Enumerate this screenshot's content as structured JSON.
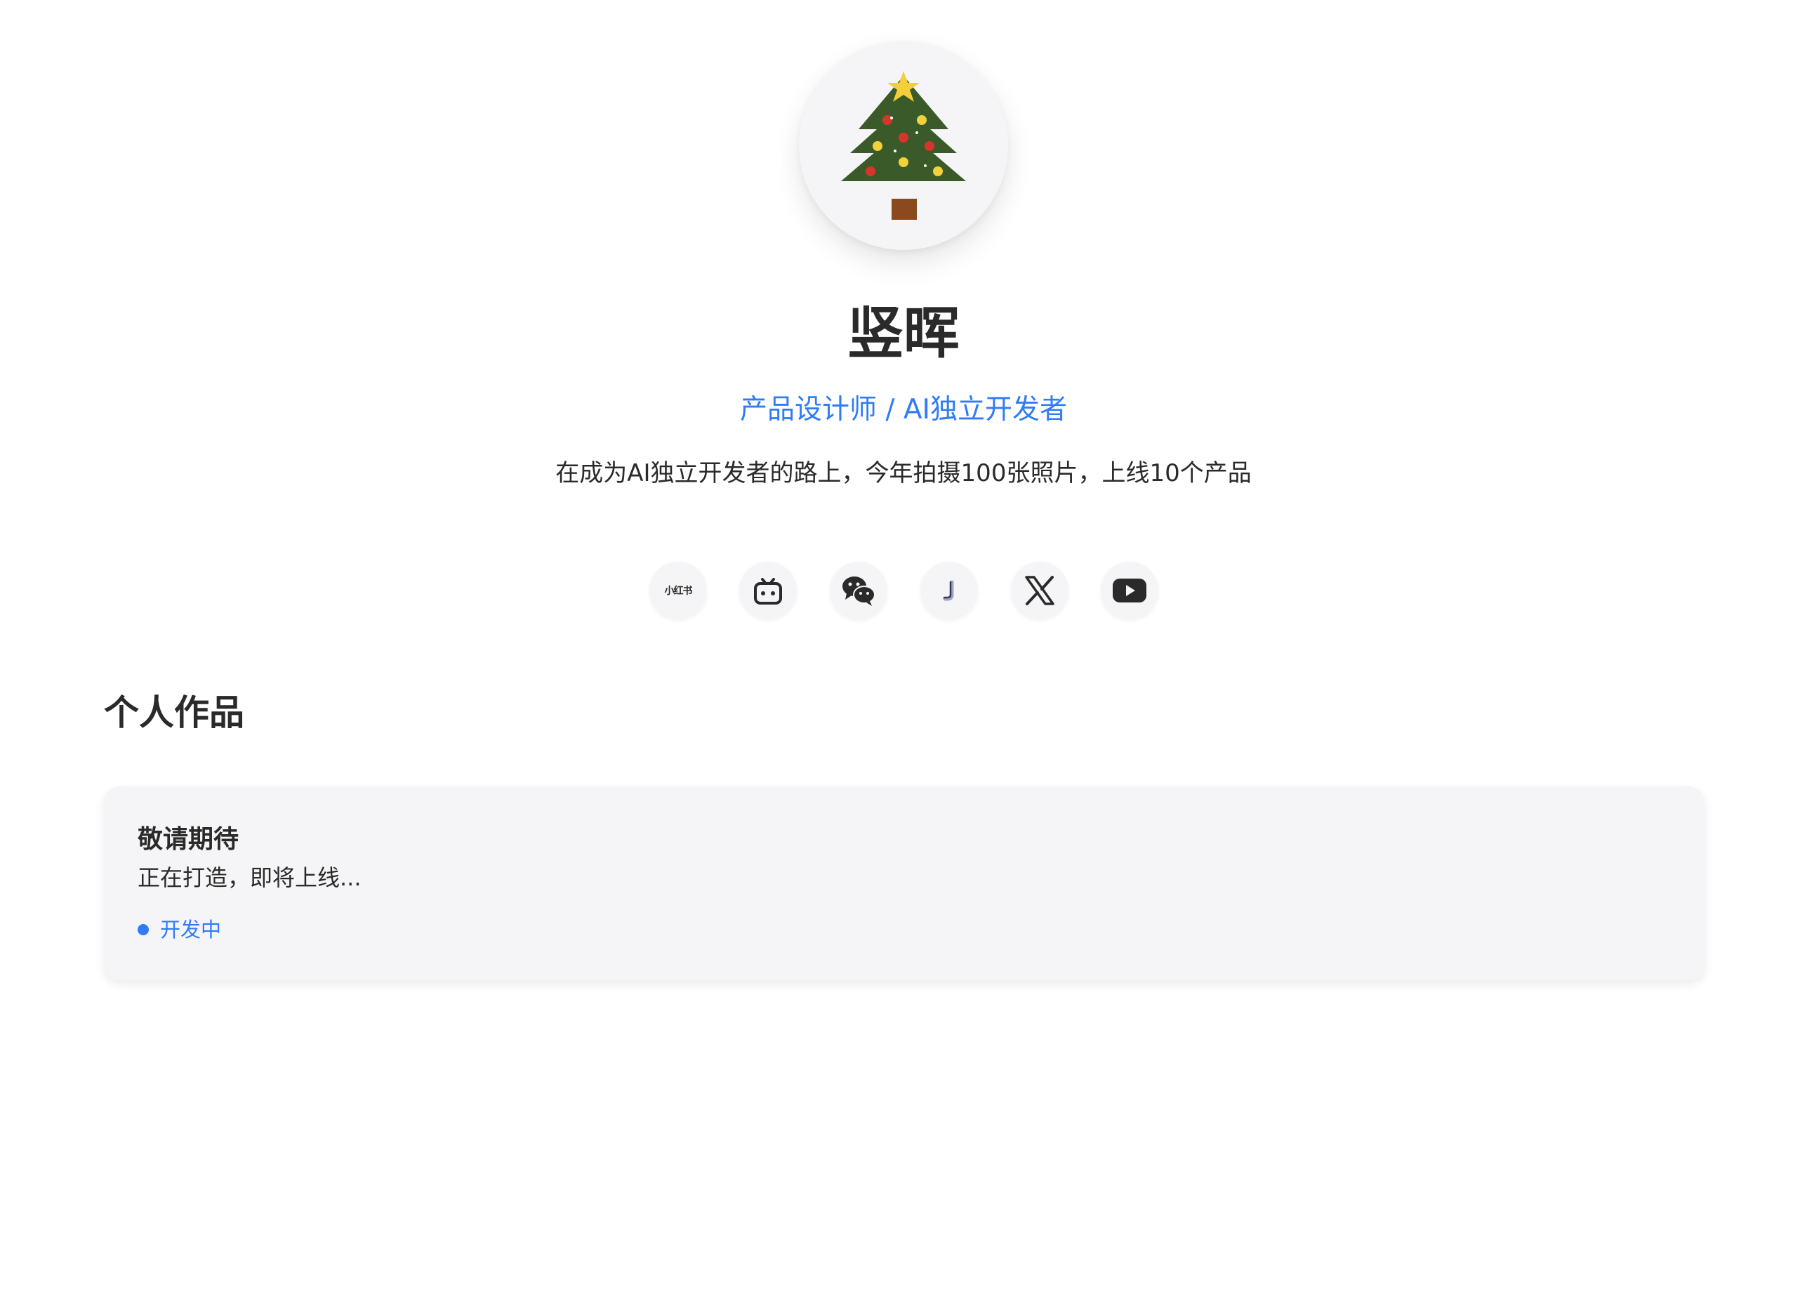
{
  "profile": {
    "avatar_icon": "christmas-tree-icon",
    "name": "竖晖",
    "role": "产品设计师 / AI独立开发者",
    "bio": "在成为AI独立开发者的路上，今年拍摄100张照片，上线10个产品"
  },
  "socials": [
    {
      "icon": "xiaohongshu-icon",
      "label": "小红书"
    },
    {
      "icon": "bilibili-icon"
    },
    {
      "icon": "wechat-icon"
    },
    {
      "icon": "jike-icon"
    },
    {
      "icon": "x-icon"
    },
    {
      "icon": "youtube-icon"
    }
  ],
  "works": {
    "title": "个人作品",
    "items": [
      {
        "title": "敬请期待",
        "description": "正在打造，即将上线...",
        "status": "开发中"
      }
    ]
  },
  "colors": {
    "accent": "#2f7cf6",
    "text": "#2a2a2a",
    "card_bg": "#f5f5f7",
    "tree_green": "#3a5a2a",
    "trunk_brown": "#8b4a1e",
    "star_gold": "#f4cf3a",
    "ornament_red": "#d9342b",
    "ornament_yellow": "#f2d23a"
  }
}
